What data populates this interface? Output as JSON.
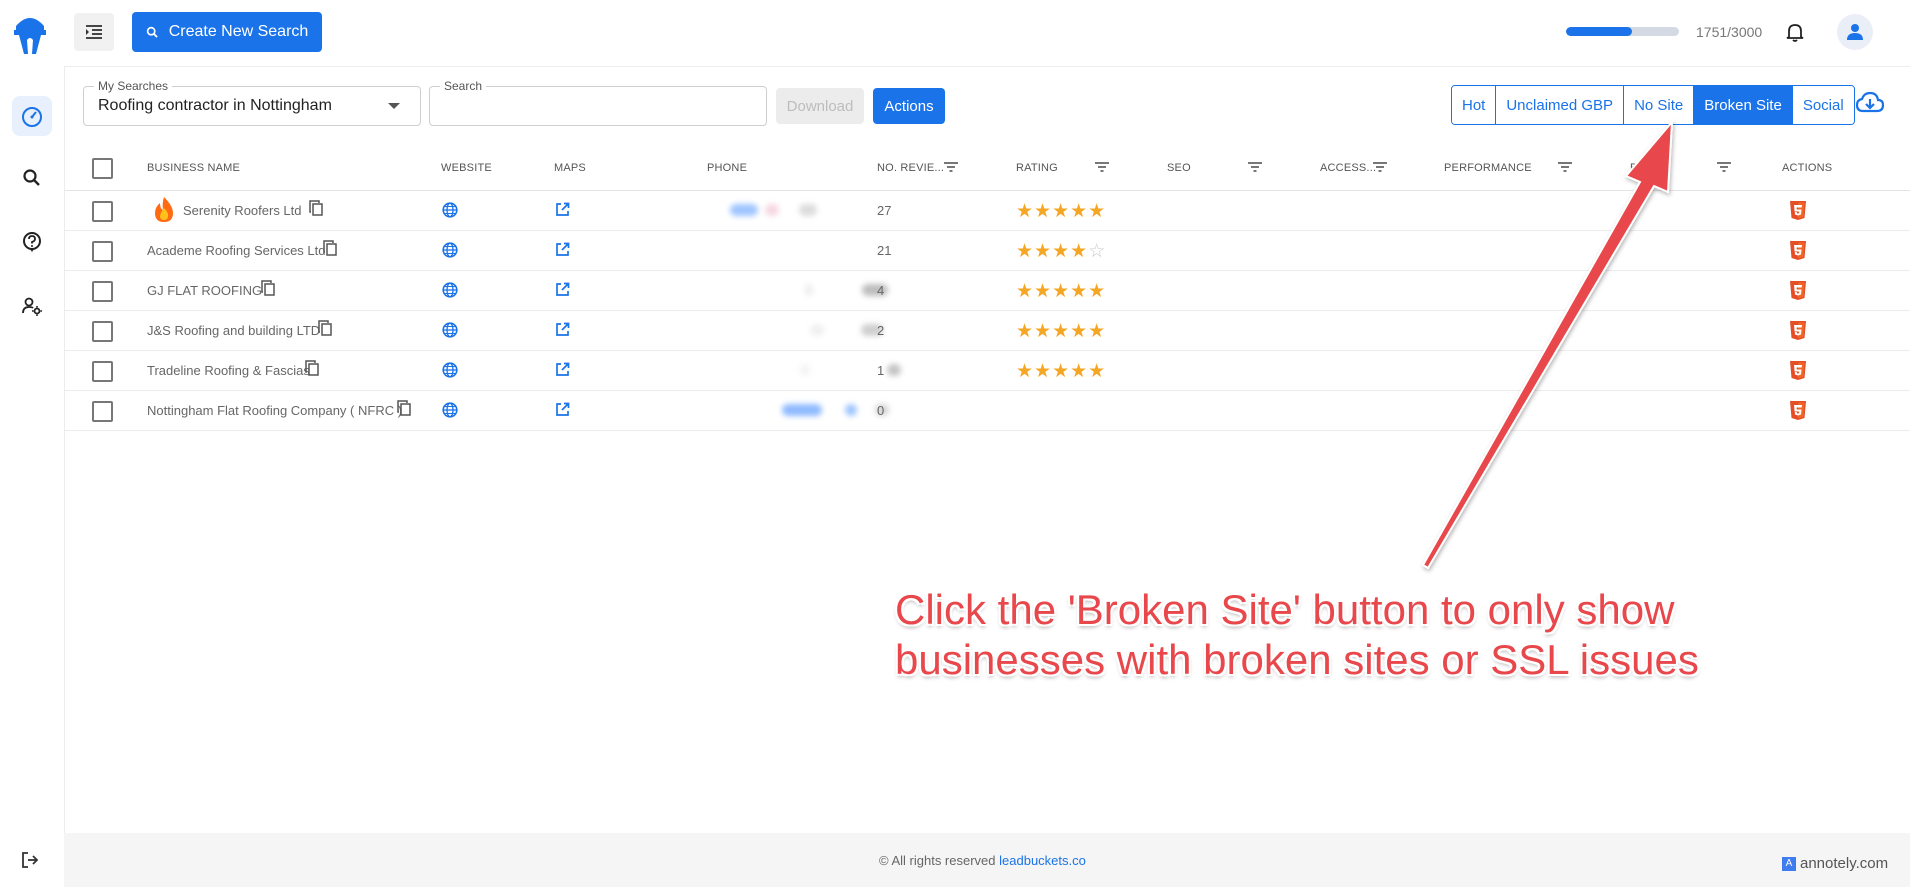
{
  "topbar": {
    "create_label": "Create New Search",
    "credits": "1751/3000",
    "credits_used": 1751,
    "credits_total": 3000
  },
  "filters": {
    "my_searches_label": "My Searches",
    "my_searches_value": "Roofing contractor in Nottingham",
    "search_label": "Search",
    "search_value": "",
    "download_label": "Download",
    "actions_label": "Actions",
    "segments": [
      "Hot",
      "Unclaimed GBP",
      "No Site",
      "Broken Site",
      "Social"
    ],
    "active_segment": "Broken Site"
  },
  "table": {
    "headers": {
      "business_name": "BUSINESS NAME",
      "website": "WEBSITE",
      "maps": "MAPS",
      "phone": "PHONE",
      "reviews": "NO. REVIE...",
      "rating": "RATING",
      "seo": "SEO",
      "access": "ACCESS...",
      "performance": "PERFORMANCE",
      "best": "BES",
      "actions": "ACTIONS"
    },
    "rows": [
      {
        "name": "Serenity Roofers Ltd",
        "reviews": "27",
        "stars": 5
      },
      {
        "name": "Academe Roofing Services Ltd",
        "reviews": "21",
        "stars": 4
      },
      {
        "name": "GJ FLAT ROOFING",
        "reviews": "4",
        "stars": 5
      },
      {
        "name": "J&S Roofing and building LTD",
        "reviews": "2",
        "stars": 5
      },
      {
        "name": "Tradeline Roofing & Fascias",
        "reviews": "1",
        "stars": 5
      },
      {
        "name": "Nottingham Flat Roofing Company ( NFRC )",
        "reviews": "0",
        "stars": 0
      }
    ]
  },
  "footer": {
    "text": "© All rights reserved",
    "link": "leadbuckets.co"
  },
  "watermark": "annotely.com",
  "annotation": {
    "line1": "Click the 'Broken Site' button to only show",
    "line2": "businesses with broken sites or SSL issues"
  },
  "colors": {
    "primary": "#1a73e8",
    "star": "#f5a623",
    "annotation": "#e8474b",
    "html5": "#e44d26"
  }
}
